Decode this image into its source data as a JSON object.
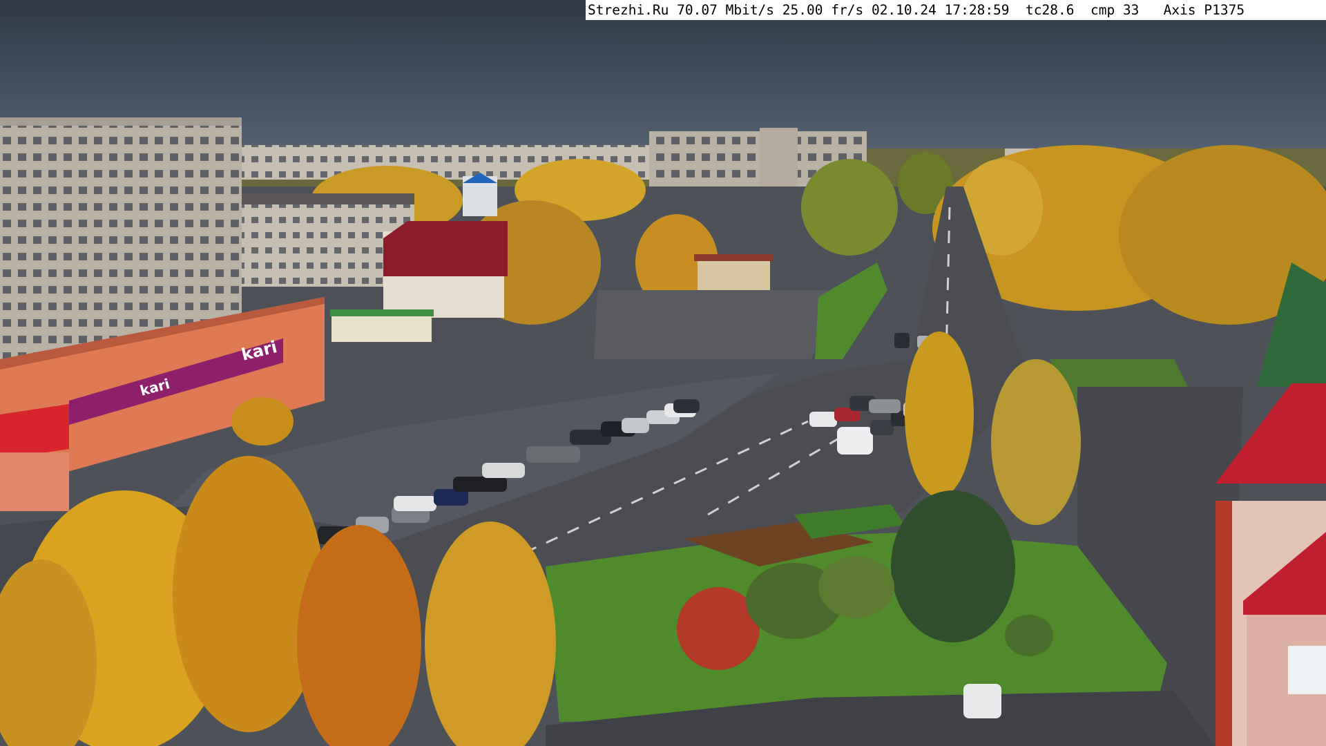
{
  "overlay": {
    "site": "Strezhi.Ru",
    "bitrate": "70.07 Mbit/s",
    "framerate": "25.00 fr/s",
    "datetime": "02.10.24 17:28:59",
    "tc": "tc28.6",
    "cmp": "cmp 33",
    "camera": "Axis P1375"
  },
  "signage": {
    "store_sign": "kari",
    "store_banner_text": "kari"
  },
  "colors": {
    "sky": "#3e4a58",
    "foliage_yellow": "#d9a21f",
    "foliage_orange": "#c97a1a",
    "grass": "#4f8a2c",
    "road": "#4a4c52",
    "kari_magenta": "#8e1f6a",
    "building_salmon": "#e07a55"
  }
}
